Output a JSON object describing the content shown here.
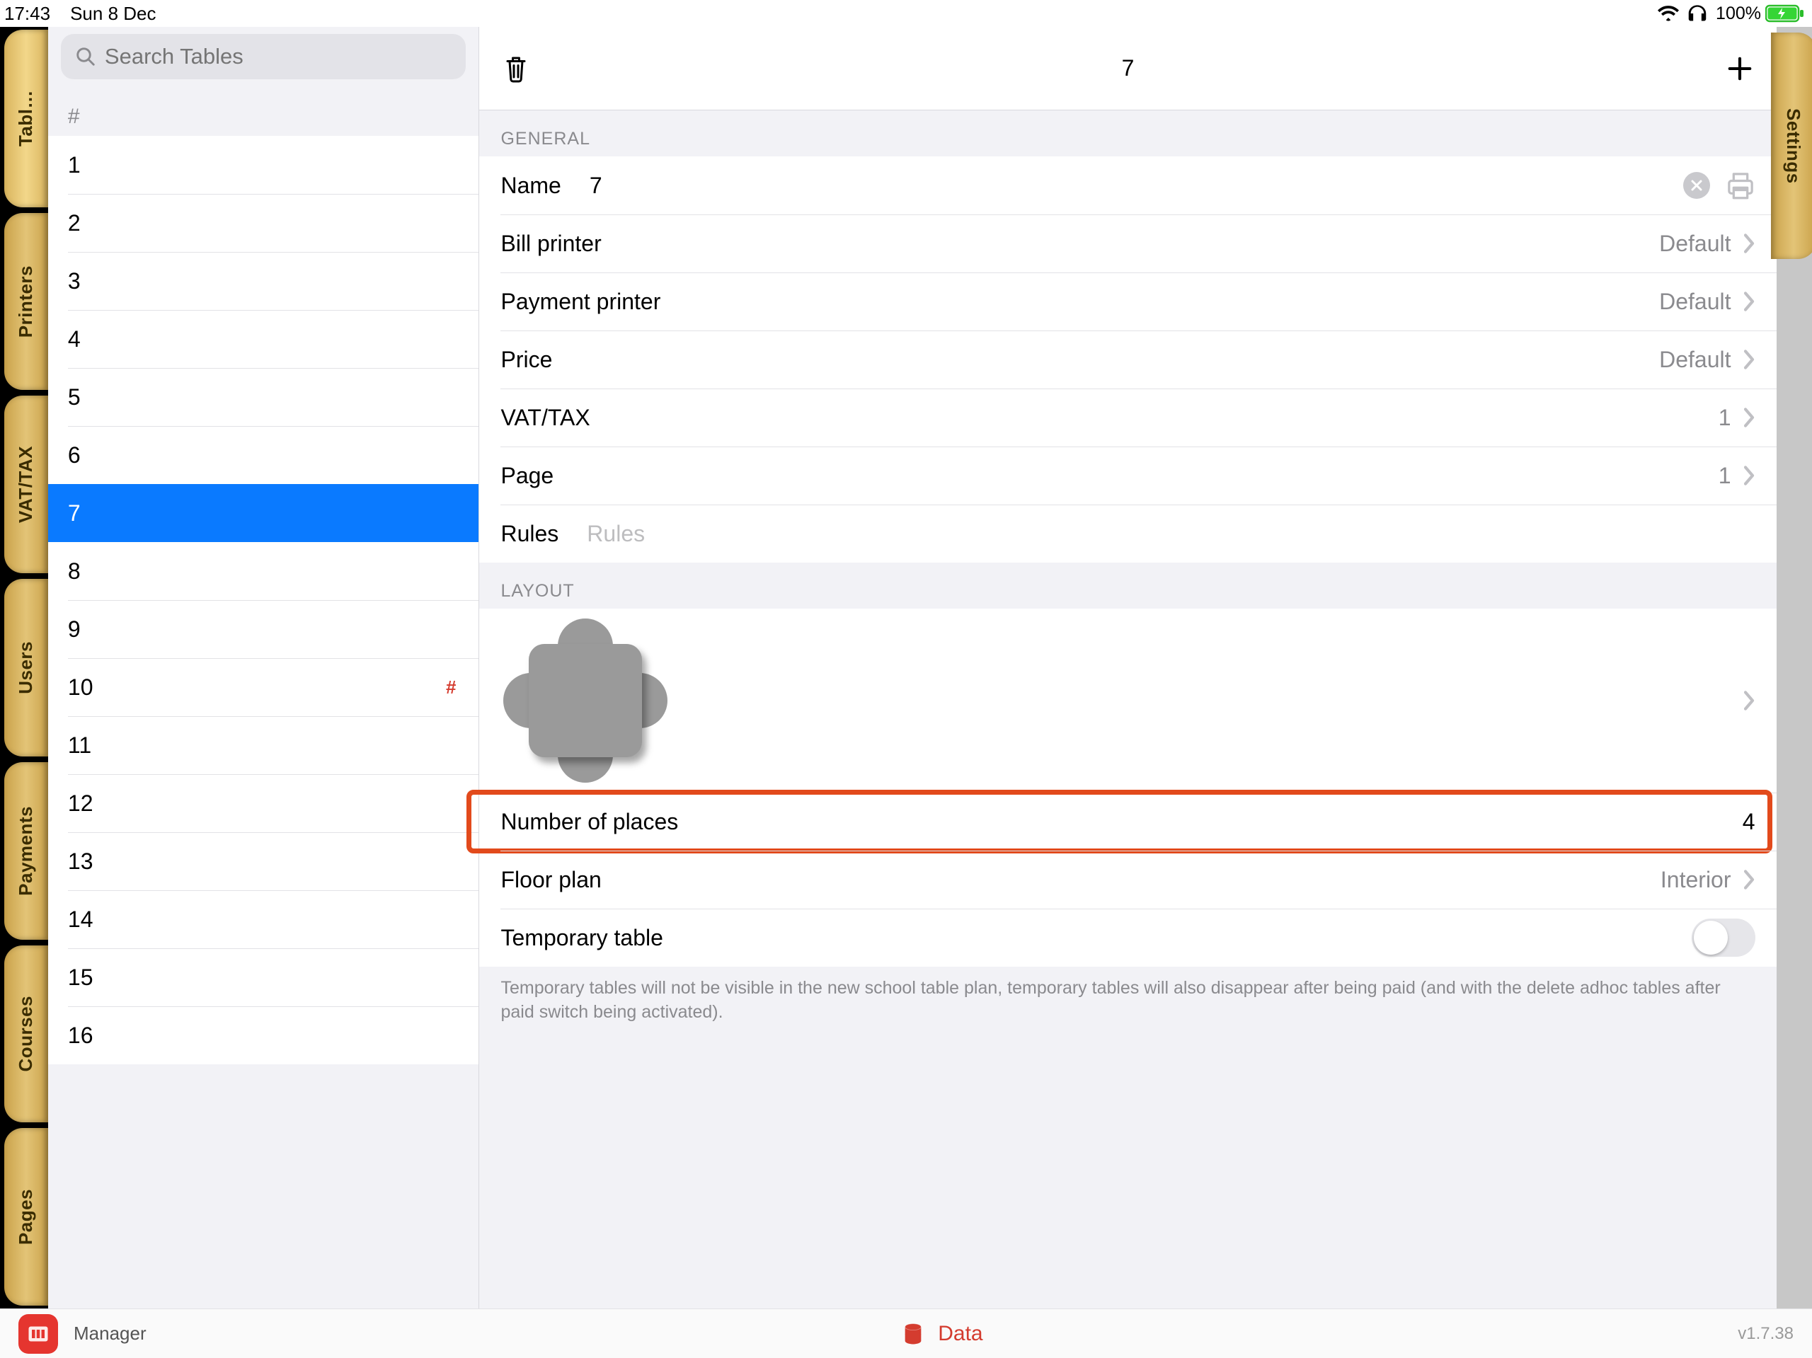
{
  "status": {
    "time": "17:43",
    "date": "Sun 8 Dec",
    "battery_pct": "100%"
  },
  "left_tabs": [
    "Tabl…",
    "Printers",
    "VAT/TAX",
    "Users",
    "Payments",
    "Courses",
    "Pages"
  ],
  "left_tab_active_index": 0,
  "right_tab": "Settings",
  "sidebar": {
    "search_placeholder": "Search Tables",
    "header": "#",
    "items": [
      {
        "label": "1"
      },
      {
        "label": "2"
      },
      {
        "label": "3"
      },
      {
        "label": "4"
      },
      {
        "label": "5"
      },
      {
        "label": "6"
      },
      {
        "label": "7",
        "selected": true
      },
      {
        "label": "8"
      },
      {
        "label": "9"
      },
      {
        "label": "10",
        "badge": "#"
      },
      {
        "label": "11"
      },
      {
        "label": "12"
      },
      {
        "label": "13"
      },
      {
        "label": "14"
      },
      {
        "label": "15"
      },
      {
        "label": "16"
      }
    ]
  },
  "detail": {
    "title": "7",
    "sections": {
      "general": {
        "label": "GENERAL",
        "name_label": "Name",
        "name_value": "7",
        "bill_printer_label": "Bill printer",
        "bill_printer_value": "Default",
        "payment_printer_label": "Payment printer",
        "payment_printer_value": "Default",
        "price_label": "Price",
        "price_value": "Default",
        "vat_label": "VAT/TAX",
        "vat_value": "1",
        "page_label": "Page",
        "page_value": "1",
        "rules_label": "Rules",
        "rules_placeholder": "Rules"
      },
      "layout": {
        "label": "LAYOUT",
        "places_label": "Number of places",
        "places_value": "4",
        "floor_plan_label": "Floor plan",
        "floor_plan_value": "Interior",
        "temp_label": "Temporary table",
        "temp_note": "Temporary tables will not be visible in the new school table plan, temporary tables will also disappear after being paid (and with the delete adhoc tables after paid switch being activated)."
      }
    }
  },
  "footer": {
    "role": "Manager",
    "center": "Data",
    "version": "v1.7.38"
  }
}
